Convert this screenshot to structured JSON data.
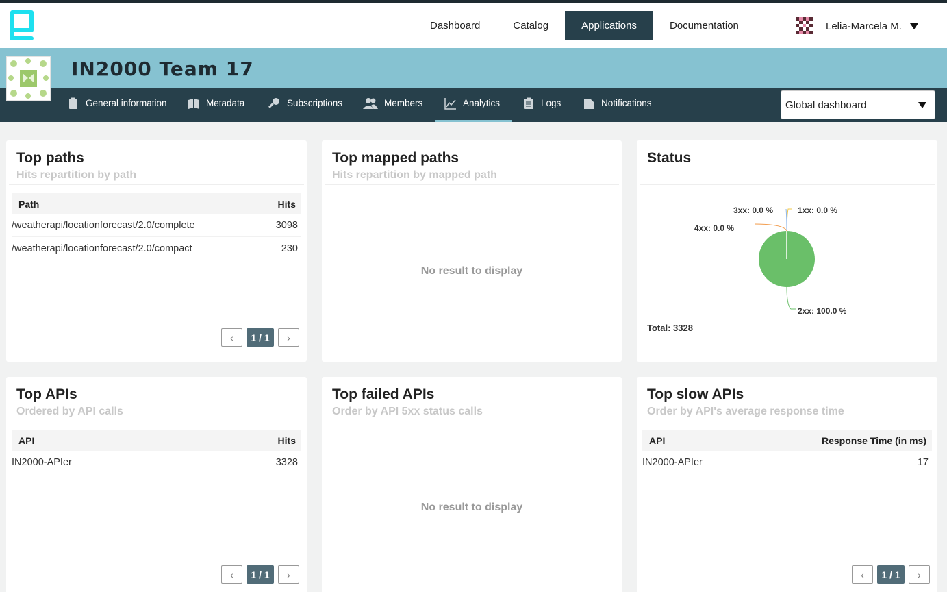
{
  "nav": {
    "items": [
      "Dashboard",
      "Catalog",
      "Applications",
      "Documentation"
    ],
    "active": "Applications",
    "user_name": "Lelia-Marcela M."
  },
  "app": {
    "title": "IN2000 Team 17"
  },
  "tabs": [
    {
      "label": "General information",
      "icon": "clipboard-icon"
    },
    {
      "label": "Metadata",
      "icon": "book-icon"
    },
    {
      "label": "Subscriptions",
      "icon": "key-icon"
    },
    {
      "label": "Members",
      "icon": "users-icon"
    },
    {
      "label": "Analytics",
      "icon": "chart-line-icon",
      "active": true
    },
    {
      "label": "Logs",
      "icon": "list-icon"
    },
    {
      "label": "Notifications",
      "icon": "document-icon"
    }
  ],
  "dashboard_select": {
    "value": "Global dashboard"
  },
  "colors": {
    "accent": "#27404b",
    "header_band": "#86c2d1",
    "logo": "#1ee0ef",
    "pie_2xx": "#6abf69"
  },
  "cards": {
    "top_paths": {
      "title": "Top paths",
      "subtitle": "Hits repartition by path",
      "columns": [
        "Path",
        "Hits"
      ],
      "rows": [
        {
          "path": "/weatherapi/locationforecast/2.0/complete",
          "hits": "3098"
        },
        {
          "path": "/weatherapi/locationforecast/2.0/compact",
          "hits": "230"
        }
      ],
      "page": "1 / 1"
    },
    "top_mapped_paths": {
      "title": "Top mapped paths",
      "subtitle": "Hits repartition by mapped path",
      "empty": "No result to display"
    },
    "status": {
      "title": "Status",
      "labels": {
        "s1xx": "1xx: 0.0 %",
        "s2xx": "2xx: 100.0 %",
        "s3xx": "3xx: 0.0 %",
        "s4xx": "4xx: 0.0 %"
      },
      "total": "Total: 3328"
    },
    "top_apis": {
      "title": "Top APIs",
      "subtitle": "Ordered by API calls",
      "columns": [
        "API",
        "Hits"
      ],
      "rows": [
        {
          "api": "IN2000-APIer",
          "hits": "3328"
        }
      ],
      "page": "1 / 1"
    },
    "top_failed_apis": {
      "title": "Top failed APIs",
      "subtitle": "Order by API 5xx status calls",
      "empty": "No result to display"
    },
    "top_slow_apis": {
      "title": "Top slow APIs",
      "subtitle": "Order by API's average response time",
      "columns": [
        "API",
        "Response Time (in ms)"
      ],
      "rows": [
        {
          "api": "IN2000-APIer",
          "time": "17"
        }
      ],
      "page": "1 / 1"
    }
  }
}
